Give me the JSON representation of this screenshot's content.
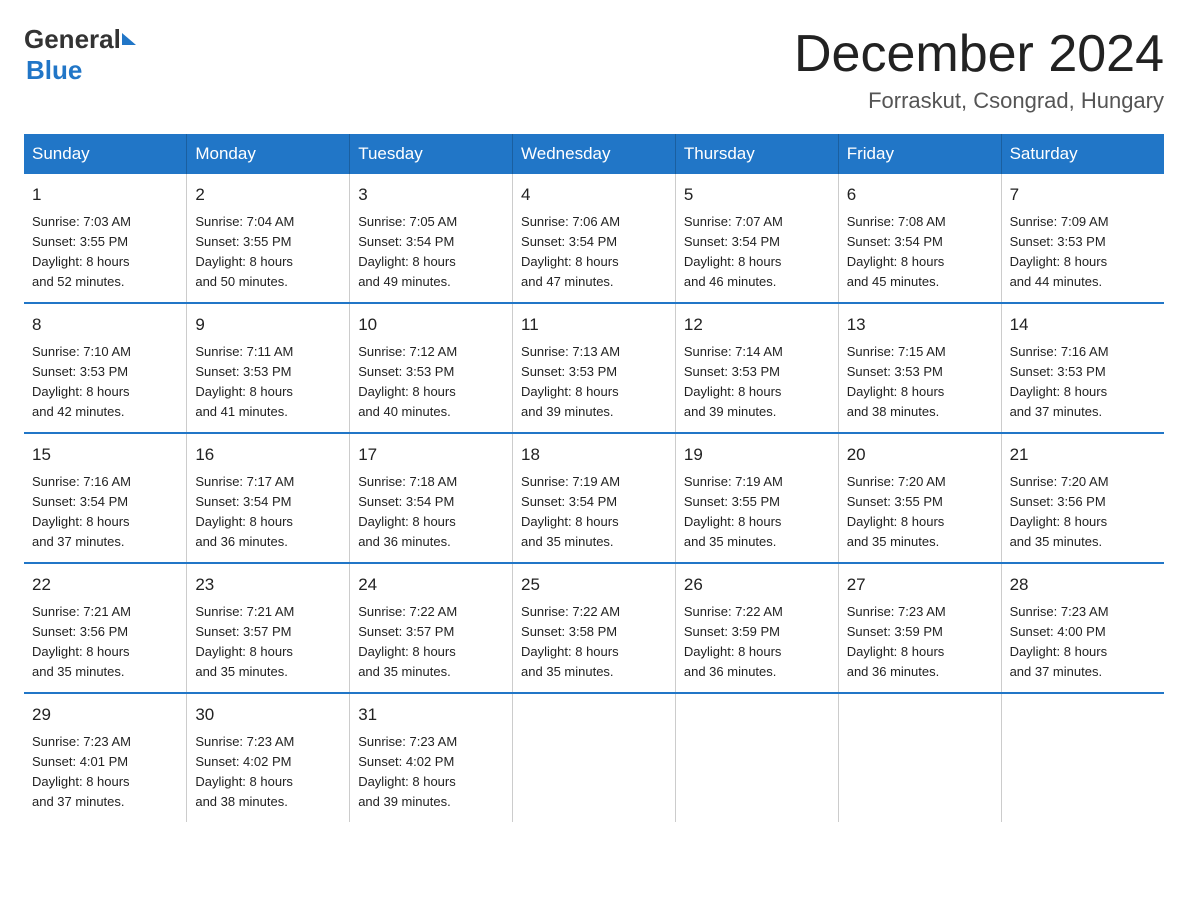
{
  "header": {
    "logo": {
      "general": "General",
      "blue": "Blue"
    },
    "title": "December 2024",
    "location": "Forraskut, Csongrad, Hungary"
  },
  "weekdays": [
    "Sunday",
    "Monday",
    "Tuesday",
    "Wednesday",
    "Thursday",
    "Friday",
    "Saturday"
  ],
  "weeks": [
    [
      {
        "day": "1",
        "sunrise": "Sunrise: 7:03 AM",
        "sunset": "Sunset: 3:55 PM",
        "daylight": "Daylight: 8 hours",
        "minutes": "and 52 minutes."
      },
      {
        "day": "2",
        "sunrise": "Sunrise: 7:04 AM",
        "sunset": "Sunset: 3:55 PM",
        "daylight": "Daylight: 8 hours",
        "minutes": "and 50 minutes."
      },
      {
        "day": "3",
        "sunrise": "Sunrise: 7:05 AM",
        "sunset": "Sunset: 3:54 PM",
        "daylight": "Daylight: 8 hours",
        "minutes": "and 49 minutes."
      },
      {
        "day": "4",
        "sunrise": "Sunrise: 7:06 AM",
        "sunset": "Sunset: 3:54 PM",
        "daylight": "Daylight: 8 hours",
        "minutes": "and 47 minutes."
      },
      {
        "day": "5",
        "sunrise": "Sunrise: 7:07 AM",
        "sunset": "Sunset: 3:54 PM",
        "daylight": "Daylight: 8 hours",
        "minutes": "and 46 minutes."
      },
      {
        "day": "6",
        "sunrise": "Sunrise: 7:08 AM",
        "sunset": "Sunset: 3:54 PM",
        "daylight": "Daylight: 8 hours",
        "minutes": "and 45 minutes."
      },
      {
        "day": "7",
        "sunrise": "Sunrise: 7:09 AM",
        "sunset": "Sunset: 3:53 PM",
        "daylight": "Daylight: 8 hours",
        "minutes": "and 44 minutes."
      }
    ],
    [
      {
        "day": "8",
        "sunrise": "Sunrise: 7:10 AM",
        "sunset": "Sunset: 3:53 PM",
        "daylight": "Daylight: 8 hours",
        "minutes": "and 42 minutes."
      },
      {
        "day": "9",
        "sunrise": "Sunrise: 7:11 AM",
        "sunset": "Sunset: 3:53 PM",
        "daylight": "Daylight: 8 hours",
        "minutes": "and 41 minutes."
      },
      {
        "day": "10",
        "sunrise": "Sunrise: 7:12 AM",
        "sunset": "Sunset: 3:53 PM",
        "daylight": "Daylight: 8 hours",
        "minutes": "and 40 minutes."
      },
      {
        "day": "11",
        "sunrise": "Sunrise: 7:13 AM",
        "sunset": "Sunset: 3:53 PM",
        "daylight": "Daylight: 8 hours",
        "minutes": "and 39 minutes."
      },
      {
        "day": "12",
        "sunrise": "Sunrise: 7:14 AM",
        "sunset": "Sunset: 3:53 PM",
        "daylight": "Daylight: 8 hours",
        "minutes": "and 39 minutes."
      },
      {
        "day": "13",
        "sunrise": "Sunrise: 7:15 AM",
        "sunset": "Sunset: 3:53 PM",
        "daylight": "Daylight: 8 hours",
        "minutes": "and 38 minutes."
      },
      {
        "day": "14",
        "sunrise": "Sunrise: 7:16 AM",
        "sunset": "Sunset: 3:53 PM",
        "daylight": "Daylight: 8 hours",
        "minutes": "and 37 minutes."
      }
    ],
    [
      {
        "day": "15",
        "sunrise": "Sunrise: 7:16 AM",
        "sunset": "Sunset: 3:54 PM",
        "daylight": "Daylight: 8 hours",
        "minutes": "and 37 minutes."
      },
      {
        "day": "16",
        "sunrise": "Sunrise: 7:17 AM",
        "sunset": "Sunset: 3:54 PM",
        "daylight": "Daylight: 8 hours",
        "minutes": "and 36 minutes."
      },
      {
        "day": "17",
        "sunrise": "Sunrise: 7:18 AM",
        "sunset": "Sunset: 3:54 PM",
        "daylight": "Daylight: 8 hours",
        "minutes": "and 36 minutes."
      },
      {
        "day": "18",
        "sunrise": "Sunrise: 7:19 AM",
        "sunset": "Sunset: 3:54 PM",
        "daylight": "Daylight: 8 hours",
        "minutes": "and 35 minutes."
      },
      {
        "day": "19",
        "sunrise": "Sunrise: 7:19 AM",
        "sunset": "Sunset: 3:55 PM",
        "daylight": "Daylight: 8 hours",
        "minutes": "and 35 minutes."
      },
      {
        "day": "20",
        "sunrise": "Sunrise: 7:20 AM",
        "sunset": "Sunset: 3:55 PM",
        "daylight": "Daylight: 8 hours",
        "minutes": "and 35 minutes."
      },
      {
        "day": "21",
        "sunrise": "Sunrise: 7:20 AM",
        "sunset": "Sunset: 3:56 PM",
        "daylight": "Daylight: 8 hours",
        "minutes": "and 35 minutes."
      }
    ],
    [
      {
        "day": "22",
        "sunrise": "Sunrise: 7:21 AM",
        "sunset": "Sunset: 3:56 PM",
        "daylight": "Daylight: 8 hours",
        "minutes": "and 35 minutes."
      },
      {
        "day": "23",
        "sunrise": "Sunrise: 7:21 AM",
        "sunset": "Sunset: 3:57 PM",
        "daylight": "Daylight: 8 hours",
        "minutes": "and 35 minutes."
      },
      {
        "day": "24",
        "sunrise": "Sunrise: 7:22 AM",
        "sunset": "Sunset: 3:57 PM",
        "daylight": "Daylight: 8 hours",
        "minutes": "and 35 minutes."
      },
      {
        "day": "25",
        "sunrise": "Sunrise: 7:22 AM",
        "sunset": "Sunset: 3:58 PM",
        "daylight": "Daylight: 8 hours",
        "minutes": "and 35 minutes."
      },
      {
        "day": "26",
        "sunrise": "Sunrise: 7:22 AM",
        "sunset": "Sunset: 3:59 PM",
        "daylight": "Daylight: 8 hours",
        "minutes": "and 36 minutes."
      },
      {
        "day": "27",
        "sunrise": "Sunrise: 7:23 AM",
        "sunset": "Sunset: 3:59 PM",
        "daylight": "Daylight: 8 hours",
        "minutes": "and 36 minutes."
      },
      {
        "day": "28",
        "sunrise": "Sunrise: 7:23 AM",
        "sunset": "Sunset: 4:00 PM",
        "daylight": "Daylight: 8 hours",
        "minutes": "and 37 minutes."
      }
    ],
    [
      {
        "day": "29",
        "sunrise": "Sunrise: 7:23 AM",
        "sunset": "Sunset: 4:01 PM",
        "daylight": "Daylight: 8 hours",
        "minutes": "and 37 minutes."
      },
      {
        "day": "30",
        "sunrise": "Sunrise: 7:23 AM",
        "sunset": "Sunset: 4:02 PM",
        "daylight": "Daylight: 8 hours",
        "minutes": "and 38 minutes."
      },
      {
        "day": "31",
        "sunrise": "Sunrise: 7:23 AM",
        "sunset": "Sunset: 4:02 PM",
        "daylight": "Daylight: 8 hours",
        "minutes": "and 39 minutes."
      },
      {
        "day": "",
        "sunrise": "",
        "sunset": "",
        "daylight": "",
        "minutes": ""
      },
      {
        "day": "",
        "sunrise": "",
        "sunset": "",
        "daylight": "",
        "minutes": ""
      },
      {
        "day": "",
        "sunrise": "",
        "sunset": "",
        "daylight": "",
        "minutes": ""
      },
      {
        "day": "",
        "sunrise": "",
        "sunset": "",
        "daylight": "",
        "minutes": ""
      }
    ]
  ]
}
